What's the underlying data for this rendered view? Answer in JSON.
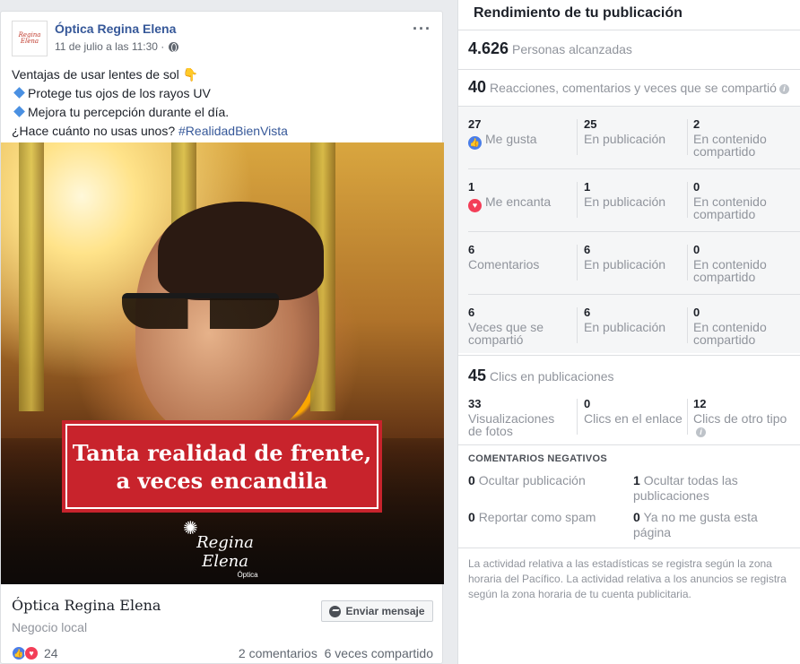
{
  "post": {
    "page_name": "Óptica Regina Elena",
    "avatar_text": "Regina Elena",
    "timestamp": "11 de julio a las 11:30 ·",
    "more_label": "···",
    "lines": [
      "Ventajas de usar lentes de sol 👇",
      "Protege tus ojos de los rayos UV",
      "Mejora tu percepción durante el día.",
      "¿Hace cuánto no usas unos? "
    ],
    "hashtag": "#RealidadBienVista",
    "image": {
      "banner_line1": "Tanta realidad de frente,",
      "banner_line2": "a veces encandila",
      "brand_script": "Regina Elena",
      "brand_small": "Óptica"
    },
    "page_title": "Óptica Regina Elena",
    "page_category": "Negocio local",
    "message_button": "Enviar mensaje",
    "reaction_count": "24",
    "stats": "2 comentarios  6 veces compartido"
  },
  "panel": {
    "title": "Rendimiento de tu publicación",
    "reach": {
      "value": "4.626",
      "label": "Personas alcanzadas"
    },
    "engagement": {
      "value": "40",
      "label": "Reacciones, comentarios y veces que se compartió"
    },
    "rows": [
      {
        "n1": "27",
        "l1": "Me gusta",
        "n2": "25",
        "l2": "En publicación",
        "n3": "2",
        "l3": "En contenido compartido"
      },
      {
        "n1": "1",
        "l1": "Me encanta",
        "n2": "1",
        "l2": "En publicación",
        "n3": "0",
        "l3": "En contenido compartido"
      },
      {
        "n1": "6",
        "l1": "Comentarios",
        "n2": "6",
        "l2": "En publicación",
        "n3": "0",
        "l3": "En contenido compartido"
      },
      {
        "n1": "6",
        "l1": "Veces que se compartió",
        "n2": "6",
        "l2": "En publicación",
        "n3": "0",
        "l3": "En contenido compartido"
      }
    ],
    "clicks": {
      "value": "45",
      "label": "Clics en publicaciones",
      "n1": "33",
      "l1": "Visualizaciones de fotos",
      "n2": "0",
      "l2": "Clics en el enlace",
      "n3": "12",
      "l3": "Clics de otro tipo"
    },
    "negative": {
      "title": "COMENTARIOS NEGATIVOS",
      "hide_post_n": "0",
      "hide_post": "Ocultar publicación",
      "hide_all_n": "1",
      "hide_all": "Ocultar todas las publicaciones",
      "spam_n": "0",
      "spam": "Reportar como spam",
      "unlike_n": "0",
      "unlike": "Ya no me gusta esta página"
    },
    "footer": "La actividad relativa a las estadísticas se registra según la zona horaria del Pacífico. La actividad relativa a los anuncios se registra según la zona horaria de tu cuenta publicitaria."
  },
  "colors": {
    "link": "#365899",
    "like": "#4a7ee8",
    "love": "#f33e58",
    "banner": "#c8232c"
  }
}
